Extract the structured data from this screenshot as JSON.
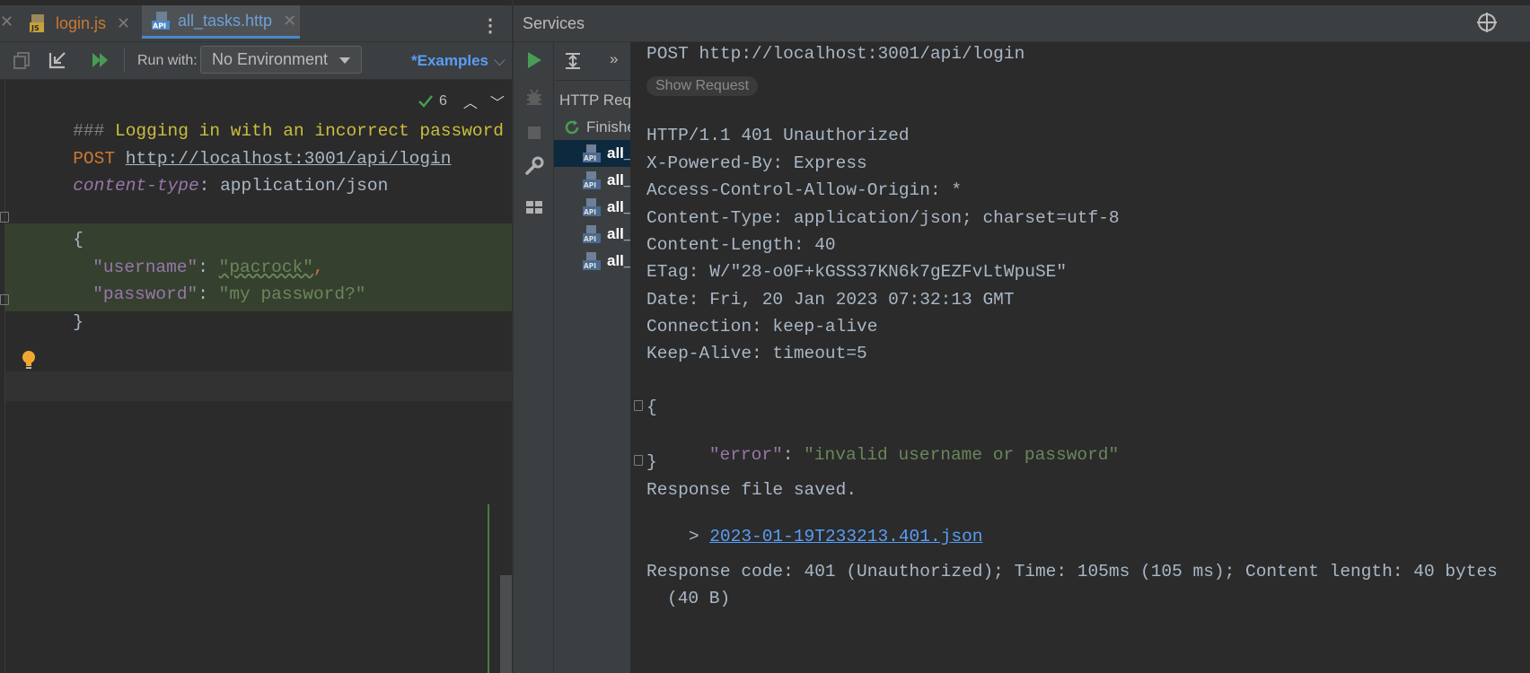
{
  "editor_tabs": [
    {
      "label": "login.js",
      "active": false,
      "icon": "js-file-icon"
    },
    {
      "label": "all_tasks.http",
      "active": true,
      "icon": "api-file-icon"
    }
  ],
  "toolbar": {
    "run_with_label": "Run with:",
    "environment": "No Environment",
    "examples_label": "*Examples"
  },
  "inspections": {
    "count": "6"
  },
  "code_lines": {
    "comment": "### Logging in with an incorrect password",
    "method": "POST",
    "url": "http://localhost:3001/api/login",
    "header_name": "content-type",
    "header_sep": ": ",
    "header_value": "application/json",
    "brace_open": "{",
    "username_key": "\"username\"",
    "username_value": "\"pacrock\"",
    "password_key": "\"password\"",
    "password_value": "\"my password?\"",
    "brace_close": "}",
    "colon": ": ",
    "comma": ","
  },
  "services": {
    "title": "Services",
    "tree": {
      "root": "HTTP Req",
      "finished": "Finishe",
      "items": [
        "all_",
        "all_",
        "all_",
        "all_",
        "all_"
      ]
    }
  },
  "response": {
    "request_line": "POST http://localhost:3001/api/login",
    "show_request_label": "Show Request",
    "status_line": "HTTP/1.1 401 Unauthorized",
    "headers": [
      "X-Powered-By: Express",
      "Access-Control-Allow-Origin: *",
      "Content-Type: application/json; charset=utf-8",
      "Content-Length: 40",
      "ETag: W/\"28-o0F+kGSS37KN6k7gEZFvLtWpuSE\"",
      "Date: Fri, 20 Jan 2023 07:32:13 GMT",
      "Connection: keep-alive",
      "Keep-Alive: timeout=5"
    ],
    "body_open": "{",
    "error_key": "\"error\"",
    "error_value": "\"invalid username or password\"",
    "body_close": "}",
    "saved_text": "Response file saved.",
    "saved_prefix": "> ",
    "saved_file": "2023-01-19T233213.401.json",
    "summary_line1": "Response code: 401 (Unauthorized); Time: 105ms (105 ms); Content length: 40 bytes",
    "summary_line2": "(40 B)"
  },
  "colors": {
    "accent": "#4a88c7",
    "run_green": "#499c54",
    "link_blue": "#589df6"
  }
}
